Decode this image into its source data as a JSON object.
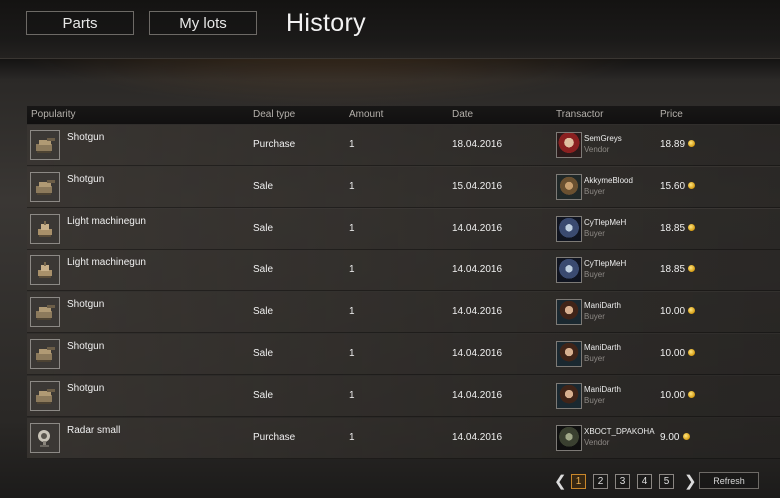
{
  "nav": {
    "parts_label": "Parts",
    "lots_label": "My lots"
  },
  "title": "History",
  "columns": {
    "item": "Popularity",
    "deal": "Deal type",
    "amount": "Amount",
    "date": "Date",
    "transactor": "Transactor",
    "price": "Price"
  },
  "rows": [
    {
      "item": "Shotgun",
      "deal": "Purchase",
      "amount": "1",
      "date": "18.04.2016",
      "transactor": "SemGreys",
      "role": "Vendor",
      "price": "18.89"
    },
    {
      "item": "Shotgun",
      "deal": "Sale",
      "amount": "1",
      "date": "15.04.2016",
      "transactor": "AkkymeBlood",
      "role": "Buyer",
      "price": "15.60"
    },
    {
      "item": "Light machinegun",
      "deal": "Sale",
      "amount": "1",
      "date": "14.04.2016",
      "transactor": "CyTlepMeH",
      "role": "Buyer",
      "price": "18.85"
    },
    {
      "item": "Light machinegun",
      "deal": "Sale",
      "amount": "1",
      "date": "14.04.2016",
      "transactor": "CyTlepMeH",
      "role": "Buyer",
      "price": "18.85"
    },
    {
      "item": "Shotgun",
      "deal": "Sale",
      "amount": "1",
      "date": "14.04.2016",
      "transactor": "ManiDarth",
      "role": "Buyer",
      "price": "10.00"
    },
    {
      "item": "Shotgun",
      "deal": "Sale",
      "amount": "1",
      "date": "14.04.2016",
      "transactor": "ManiDarth",
      "role": "Buyer",
      "price": "10.00"
    },
    {
      "item": "Shotgun",
      "deal": "Sale",
      "amount": "1",
      "date": "14.04.2016",
      "transactor": "ManiDarth",
      "role": "Buyer",
      "price": "10.00"
    },
    {
      "item": "Radar small",
      "deal": "Purchase",
      "amount": "1",
      "date": "14.04.2016",
      "transactor": "XBOCT_DPAKOHA",
      "role": "Vendor",
      "price": "9.00"
    }
  ],
  "pagination": {
    "pages": [
      "1",
      "2",
      "3",
      "4",
      "5"
    ],
    "current": "1",
    "prev_icon": "chevron-left-icon",
    "next_icon": "chevron-right-icon"
  },
  "refresh_label": "Refresh",
  "colors": {
    "accent": "#c8862a",
    "coin": "#e0a820"
  }
}
